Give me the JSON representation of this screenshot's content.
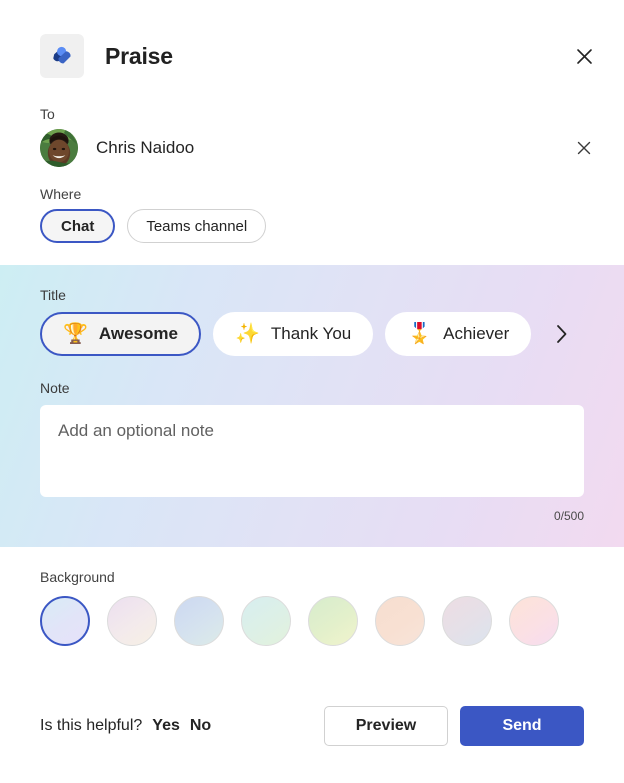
{
  "header": {
    "app_icon_name": "praise-app-icon",
    "title": "Praise",
    "close_label": "✕"
  },
  "to": {
    "label": "To",
    "recipient_name": "Chris Naidoo",
    "remove_label": "✕"
  },
  "where": {
    "label": "Where",
    "options": [
      {
        "label": "Chat",
        "selected": true
      },
      {
        "label": "Teams channel",
        "selected": false
      }
    ]
  },
  "title_section": {
    "label": "Title",
    "badges": [
      {
        "label": "Awesome",
        "emoji": "🏆",
        "icon_name": "trophy-icon",
        "selected": true
      },
      {
        "label": "Thank You",
        "emoji": "✨",
        "icon_name": "sparkles-icon",
        "selected": false
      },
      {
        "label": "Achiever",
        "emoji": "🎖️",
        "icon_name": "medal-icon",
        "selected": false
      }
    ],
    "next_label": "›"
  },
  "note_section": {
    "label": "Note",
    "value": "",
    "placeholder": "Add an optional note",
    "char_count": "0/500"
  },
  "background_section": {
    "label": "Background",
    "swatches": [
      {
        "name": "lavender-blue",
        "gradient": "linear-gradient(145deg, #d8ecf6 0%, #e2e4f8 55%, #e6e2fa 100%)",
        "selected": true
      },
      {
        "name": "pink-cream",
        "gradient": "linear-gradient(145deg, #ecdff0 0%, #f3eaec 55%, #f7f0e4 100%)",
        "selected": false
      },
      {
        "name": "blue-steel",
        "gradient": "linear-gradient(145deg, #ccd8f1 0%, #d5e2ef 55%, #dcebe8 100%)",
        "selected": false
      },
      {
        "name": "mint-teal",
        "gradient": "linear-gradient(145deg, #d7eef0 0%, #ddf0e6 55%, #e2f2dc 100%)",
        "selected": false
      },
      {
        "name": "green-lime",
        "gradient": "linear-gradient(145deg, #d7eccd 0%, #e3f0cb 55%, #f1f4cc 100%)",
        "selected": false
      },
      {
        "name": "peach-orange",
        "gradient": "linear-gradient(145deg, #f6ded0 0%, #f8e0d2 55%, #f7e4d9 100%)",
        "selected": false
      },
      {
        "name": "rose-gray",
        "gradient": "linear-gradient(145deg, #eddde3 0%, #e5e0e8 55%, #dbe4ee 100%)",
        "selected": false
      },
      {
        "name": "peach-pink",
        "gradient": "linear-gradient(145deg, #fce3d8 0%, #fbe0e4 55%, #f6dcf0 100%)",
        "selected": false
      }
    ]
  },
  "footer": {
    "helpful_question": "Is this helpful?",
    "yes_label": "Yes",
    "no_label": "No",
    "preview_label": "Preview",
    "send_label": "Send"
  },
  "colors": {
    "accent": "#3b57c4",
    "surface": "#ffffff",
    "text": "#242424"
  }
}
